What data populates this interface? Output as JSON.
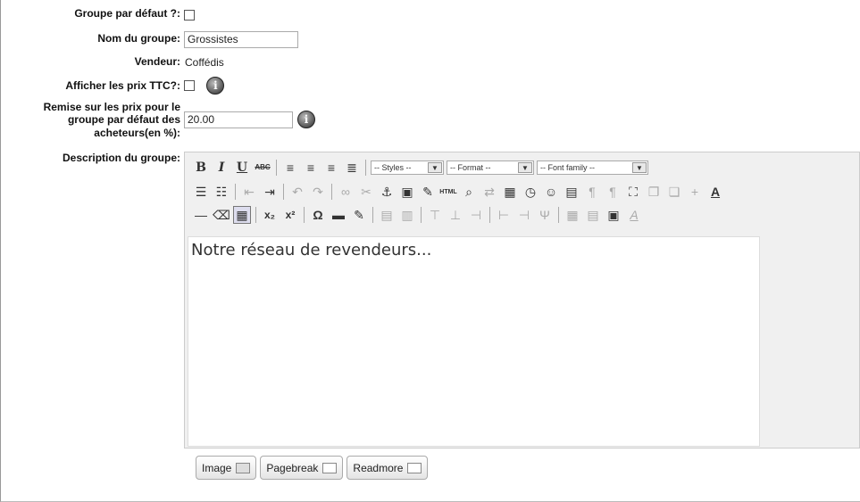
{
  "form": {
    "default_group_label": "Groupe par défaut ?:",
    "group_name_label": "Nom du groupe:",
    "group_name_value": "Grossistes",
    "vendor_label": "Vendeur:",
    "vendor_value": "Coffédis",
    "show_ttc_label": "Afficher les prix TTC?:",
    "discount_label_lines": [
      "Remise sur les prix pour le",
      "groupe par défaut des",
      "acheteurs(en %):"
    ],
    "discount_value": "20.00",
    "description_label": "Description du groupe:"
  },
  "editor": {
    "styles_select": "-- Styles --",
    "format_select": "-- Format --",
    "font_family_select": "-- Font family --",
    "content": "Notre réseau de revendeurs..."
  },
  "buttons": {
    "image": "Image",
    "pagebreak": "Pagebreak",
    "readmore": "Readmore"
  }
}
